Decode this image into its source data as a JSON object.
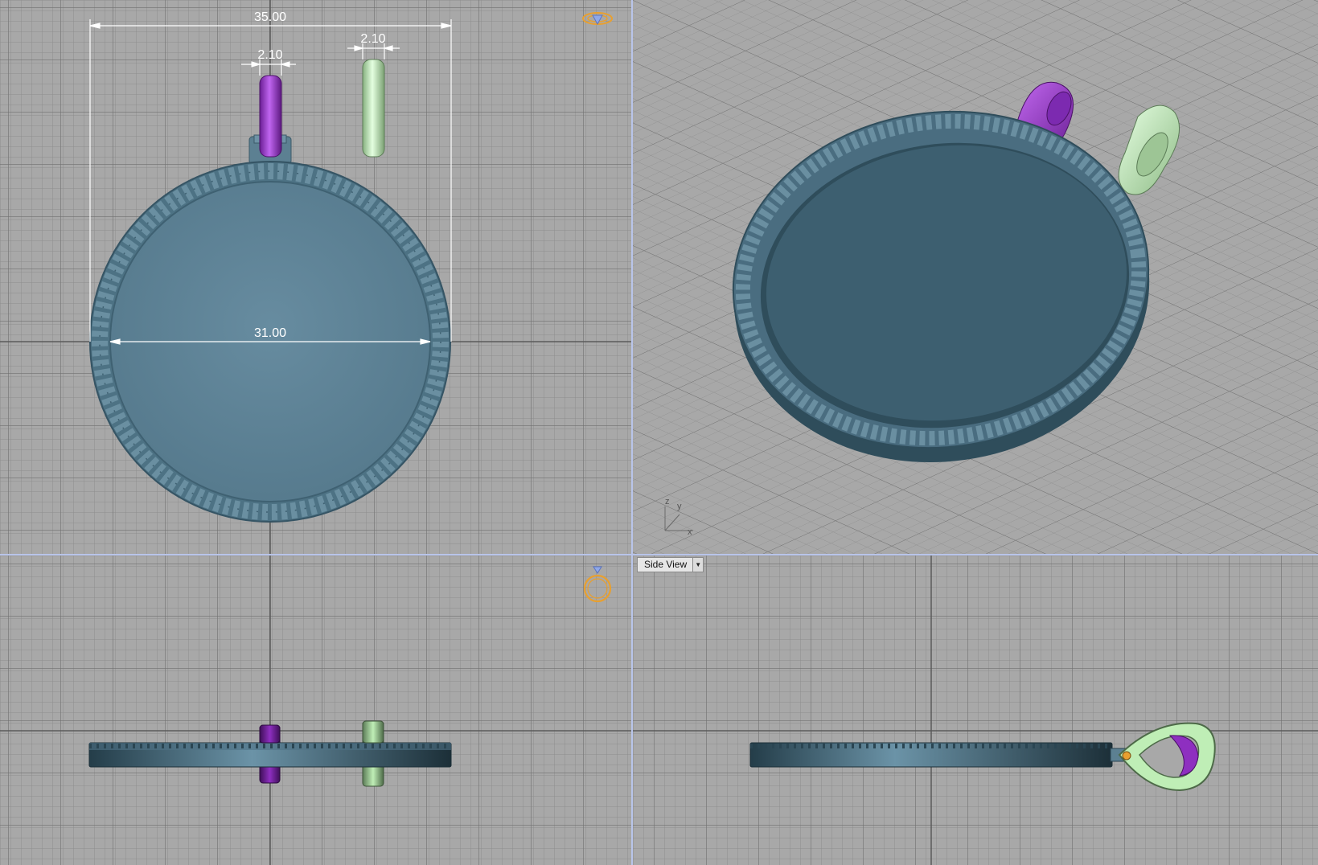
{
  "viewports": {
    "top": {
      "dimensions": {
        "overall_width": "35.00",
        "inner_diameter": "31.00",
        "bail_purple_width": "2.10",
        "bail_green_width": "2.10"
      },
      "gizmo_icon": "ring-with-diamond-icon"
    },
    "perspective": {
      "axis_labels": {
        "z": "z",
        "y": "y",
        "x": "x"
      }
    },
    "front": {
      "gizmo_icon": "ring-front-icon"
    },
    "side": {
      "view_selector_label": "Side View"
    }
  },
  "colors": {
    "grid_background": "#a8a8a8",
    "body_teal": "#5c8092",
    "purple_bail": "#8e2fc0",
    "green_bail": "#bfeeb6",
    "divider": "#b9c5ea",
    "gizmo_orange": "#e8a030"
  }
}
